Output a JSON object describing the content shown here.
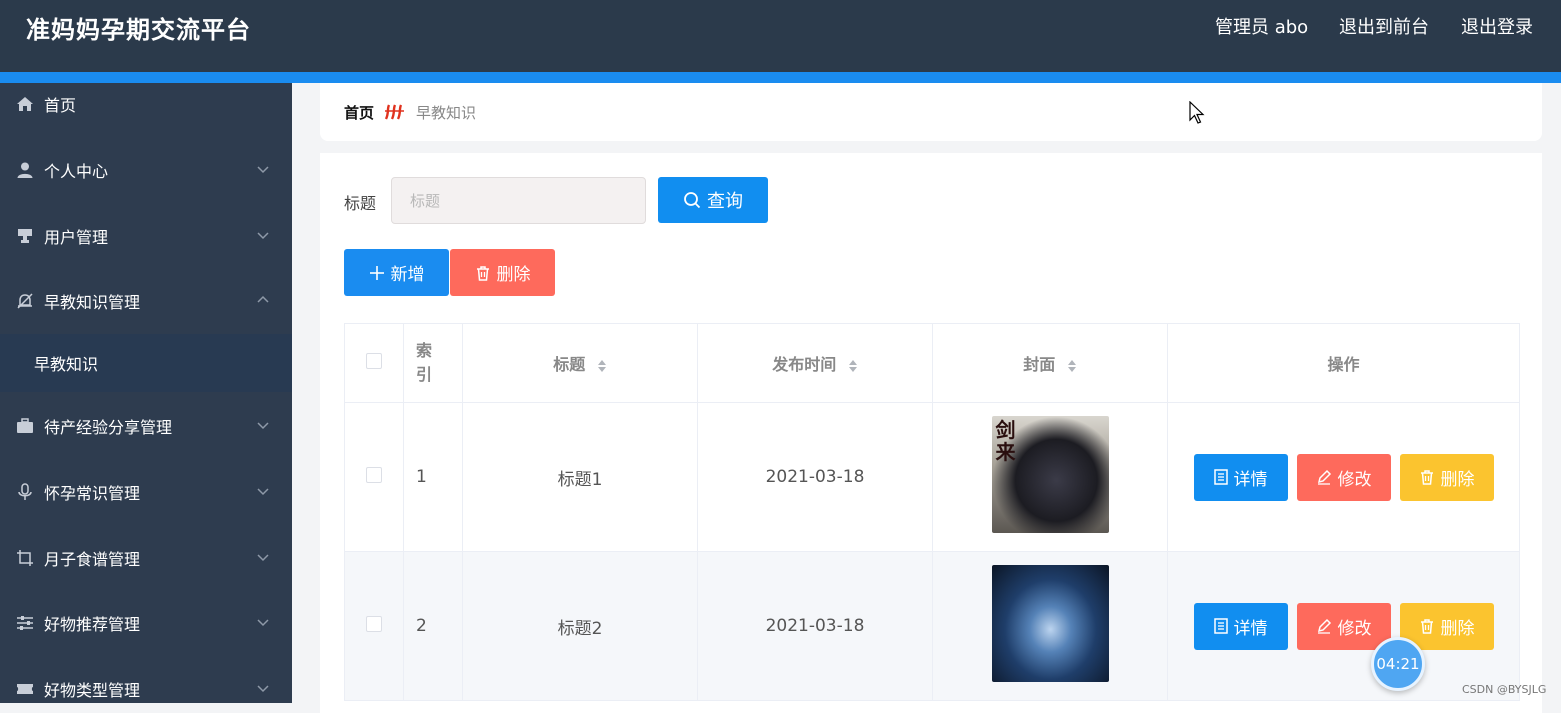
{
  "header": {
    "title": "准妈妈孕期交流平台",
    "admin_label": "管理员 abo",
    "exit_front_label": "退出到前台",
    "logout_label": "退出登录"
  },
  "sidebar": {
    "items": [
      {
        "label": "首页",
        "icon": "home-icon"
      },
      {
        "label": "个人中心",
        "icon": "user-icon"
      },
      {
        "label": "用户管理",
        "icon": "stamp-icon"
      },
      {
        "label": "早教知识管理",
        "icon": "bell-off-icon"
      },
      {
        "label": "待产经验分享管理",
        "icon": "briefcase-icon"
      },
      {
        "label": "怀孕常识管理",
        "icon": "microphone-icon"
      },
      {
        "label": "月子食谱管理",
        "icon": "crop-icon"
      },
      {
        "label": "好物推荐管理",
        "icon": "sliders-icon"
      },
      {
        "label": "好物类型管理",
        "icon": "ticket-icon"
      }
    ],
    "active_sub": "早教知识"
  },
  "breadcrumb": {
    "home": "首页",
    "current": "早教知识"
  },
  "search": {
    "label": "标题",
    "placeholder": "标题",
    "query_label": "查询"
  },
  "actions": {
    "add_label": "新增",
    "delete_label": "删除"
  },
  "table": {
    "headers": {
      "index": "索引",
      "title": "标题",
      "date": "发布时间",
      "cover": "封面",
      "ops": "操作"
    },
    "rows": [
      {
        "index": "1",
        "title": "标题1",
        "date": "2021-03-18",
        "cover_text": "剑来"
      },
      {
        "index": "2",
        "title": "标题2",
        "date": "2021-03-18"
      }
    ],
    "op_labels": {
      "detail": "详情",
      "edit": "修改",
      "delete": "删除"
    }
  },
  "overlay": {
    "timer": "04:21",
    "watermark": "CSDN @BYSJLG"
  },
  "colors": {
    "header_bg": "#2b3a4b",
    "accent": "#1a8cf0",
    "danger": "#fe6a5c",
    "warning": "#fbc42f",
    "sidebar_bg": "#2e3c4f"
  }
}
